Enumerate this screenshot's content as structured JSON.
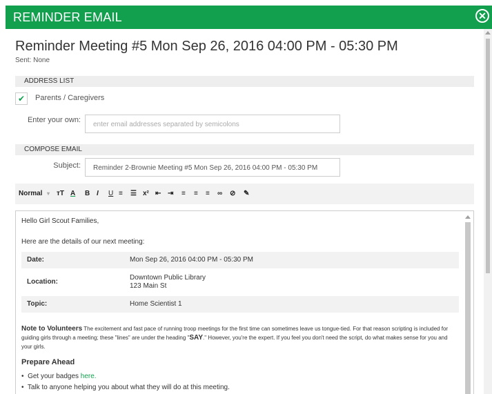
{
  "modal": {
    "title": "REMINDER EMAIL",
    "close_glyph": "✕"
  },
  "meeting": {
    "title": "Reminder Meeting #5 Mon Sep 26, 2016 04:00 PM - 05:30 PM",
    "sent": "Sent: None"
  },
  "address_list": {
    "heading": "ADDRESS LIST",
    "checkbox_label": "Parents / Caregivers",
    "checked": true,
    "own_label": "Enter your own:",
    "own_placeholder": "enter email addresses separated by semicolons"
  },
  "compose": {
    "heading": "COMPOSE EMAIL",
    "subject_label": "Subject:",
    "subject_value": "Reminder 2-Brownie Meeting #5 Mon Sep 26, 2016 04:00 PM - 05:30 PM"
  },
  "toolbar": {
    "format": "Normal",
    "format_caret": "▾",
    "text_size": "тT",
    "text_color": "A",
    "bold": "B",
    "italic": "I",
    "underline": "U",
    "ordered_list": "≡",
    "bullet_list": "☰",
    "superscript": "x²",
    "indent_decrease": "⇤",
    "indent_increase": "⇥",
    "align_left": "≡",
    "align_center": "≡",
    "align_right": "≡",
    "link": "∞",
    "unlink": "⊘",
    "clean": "✎"
  },
  "body": {
    "greeting": "Hello Girl Scout Families,",
    "intro": "Here are the details of our next meeting:",
    "details": [
      {
        "key": "Date:",
        "value": "Mon Sep 26, 2016 04:00 PM - 05:30 PM"
      },
      {
        "key": "Location:",
        "value_line1": "Downtown Public Library",
        "value_line2": "123 Main St"
      },
      {
        "key": "Topic:",
        "value": "Home Scientist 1"
      }
    ],
    "note_heading": "Note to Volunteers",
    "note_text_1": " The excitement and fast pace of running troop meetings for the first time can sometimes leave us tongue-tied. For that reason scripting is included for guiding girls through a meeting; these \"lines\" are under the heading \"",
    "note_say": "SAY",
    "note_text_2": ".\" However, you're the expert. If you feel you don't need the script, do what makes sense for you and your girls.",
    "prepare_heading": "Prepare Ahead",
    "bullets": [
      {
        "text": "Get your badges ",
        "link": "here."
      },
      {
        "text": "Talk to anyone helping you about what they will do at this meeting."
      }
    ]
  },
  "colors": {
    "brand_green": "#12a04e",
    "section_bg": "#eeeeee"
  }
}
